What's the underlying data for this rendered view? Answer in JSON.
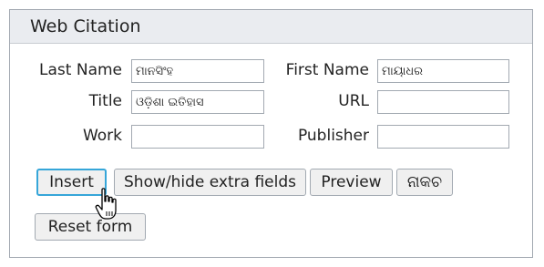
{
  "panel": {
    "title": "Web Citation"
  },
  "fields": {
    "last_name": {
      "label": "Last Name",
      "value": "ମାନସିଂହ"
    },
    "first_name": {
      "label": "First Name",
      "value": "ମାୟାଧର"
    },
    "title": {
      "label": "Title",
      "value": "ଓଡ଼ିଶା ଇତିହାସ"
    },
    "url": {
      "label": "URL",
      "value": ""
    },
    "work": {
      "label": "Work",
      "value": ""
    },
    "publisher": {
      "label": "Publisher",
      "value": ""
    }
  },
  "buttons": {
    "insert": "Insert",
    "show_hide": "Show/hide extra fields",
    "preview": "Preview",
    "cancel": "ନାକଚ",
    "reset": "Reset form"
  },
  "cursor": {
    "icon": "hand-pointer-icon"
  },
  "colors": {
    "header_bg": "#eaecf0",
    "border": "#a2a9b1",
    "focus": "#36a6d9",
    "button_bg": "#f0f0f0"
  }
}
